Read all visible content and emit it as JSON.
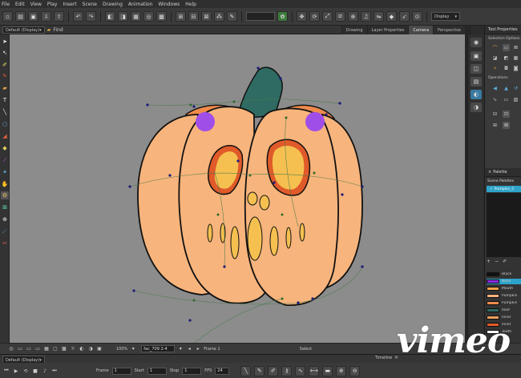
{
  "menu": [
    "File",
    "Edit",
    "View",
    "Play",
    "Insert",
    "Scene",
    "Drawing",
    "Animation",
    "Windows",
    "Help"
  ],
  "toolbar": {
    "display_dropdown": "Display"
  },
  "view": {
    "default_display": "Default (Display)",
    "file_tab": "Find",
    "tabs": [
      "Drawing",
      "Layer Properties",
      "Camera",
      "Perspective"
    ],
    "active_tab": "Camera"
  },
  "tool_properties": {
    "title": "Tool Properties",
    "section_options": "Selection Options",
    "section_operations": "Operations"
  },
  "palette": {
    "tab": "Palette",
    "scene_palettes_label": "Scene Palettes",
    "palette_item": "Pumpkin_C",
    "colours": [
      {
        "name": "Black",
        "hex": "#111111"
      },
      {
        "name": "Nose",
        "hex": "#8a2be2"
      },
      {
        "name": "Mouth",
        "hex": "#f2a24a"
      },
      {
        "name": "Pumpkin",
        "hex": "#f7b47c"
      },
      {
        "name": "Pumpkin",
        "hex": "#f08a4a"
      },
      {
        "name": "Roof",
        "hex": "#2f6b62"
      },
      {
        "name": "Inner",
        "hex": "#f5a05a"
      },
      {
        "name": "Inner",
        "hex": "#e05a2a"
      },
      {
        "name": "Teeth",
        "hex": "#ffffff"
      }
    ]
  },
  "statusbar": {
    "zoom": "100%",
    "frame_field": "fac_709 2-4",
    "frame_label": "Frame 1",
    "mode": "Select"
  },
  "timeline": {
    "display": "Default (Display)",
    "title": "Timeline",
    "frame_label": "Frame",
    "frame_value": "1",
    "start_label": "Start",
    "start_value": "1",
    "stop_label": "Stop",
    "stop_value": "1",
    "fps_label": "FPS",
    "fps_value": "24"
  },
  "watermark": "vimeo",
  "colors": {
    "pumpkin_body": "#f7b47c",
    "pumpkin_outline": "#111111",
    "pumpkin_inner": "#f08a4a",
    "stem": "#2f6b62",
    "pivot": "#a04ee8",
    "canvas_bg": "#8c8c8c",
    "accent": "#2ea3c9"
  }
}
